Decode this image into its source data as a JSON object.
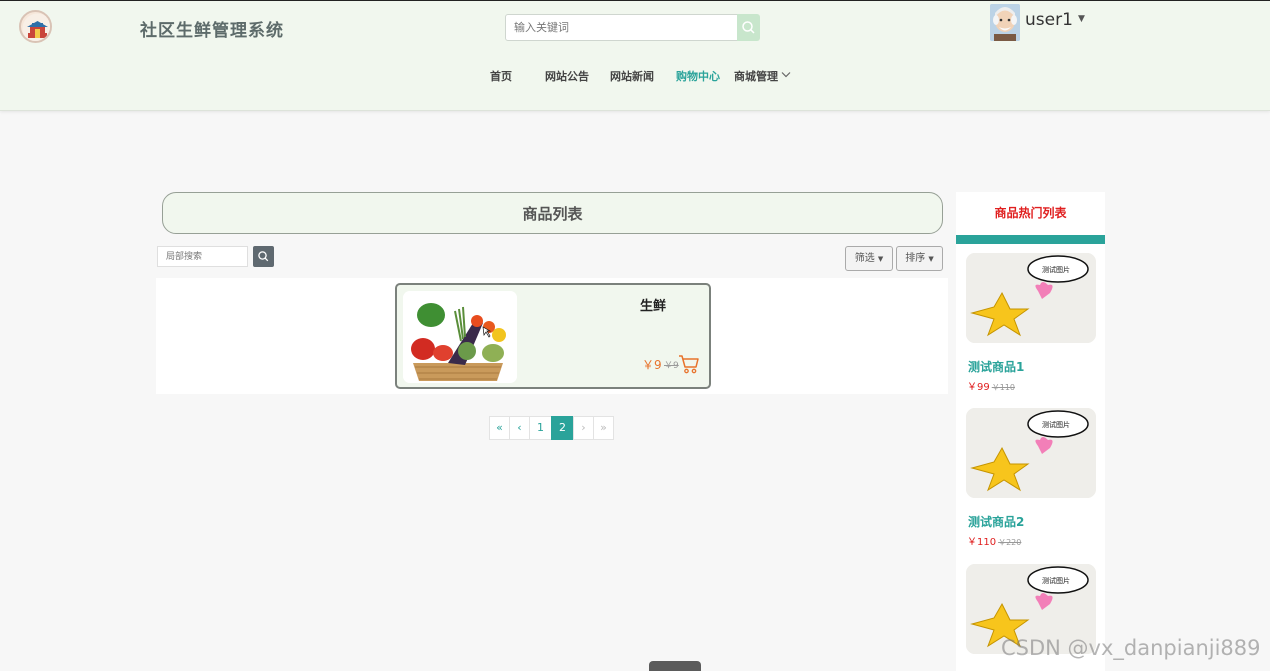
{
  "header": {
    "site_title": "社区生鲜管理系统",
    "search_placeholder": "输入关键词",
    "username": "user1",
    "nav": [
      {
        "label": "首页"
      },
      {
        "label": "网站公告"
      },
      {
        "label": "网站新闻"
      },
      {
        "label": "购物中心",
        "active": true
      },
      {
        "label": "商城管理",
        "has_dropdown": true
      }
    ]
  },
  "main": {
    "list_title": "商品列表",
    "local_search_placeholder": "局部搜索",
    "filter_label": "筛选",
    "sort_label": "排序",
    "products": [
      {
        "name": "生鲜",
        "price": "￥9",
        "old_price": "￥9"
      }
    ],
    "pagination": {
      "first": "«",
      "prev": "‹",
      "pages": [
        "1",
        "2"
      ],
      "current": "2",
      "next": "›",
      "last": "»"
    }
  },
  "sidebar": {
    "title": "商品热门列表",
    "items": [
      {
        "name": "测试商品1",
        "price": "￥99",
        "old_price": "￥110"
      },
      {
        "name": "测试商品2",
        "price": "￥110",
        "old_price": "￥220"
      },
      {
        "name": "",
        "price": "",
        "old_price": ""
      }
    ]
  },
  "watermark": "CSDN @vx_danpianji889",
  "colors": {
    "accent": "#2aa39a",
    "header_bg": "#f1f7ee",
    "hot_title": "#e02020",
    "price_orange": "#e8732c"
  }
}
